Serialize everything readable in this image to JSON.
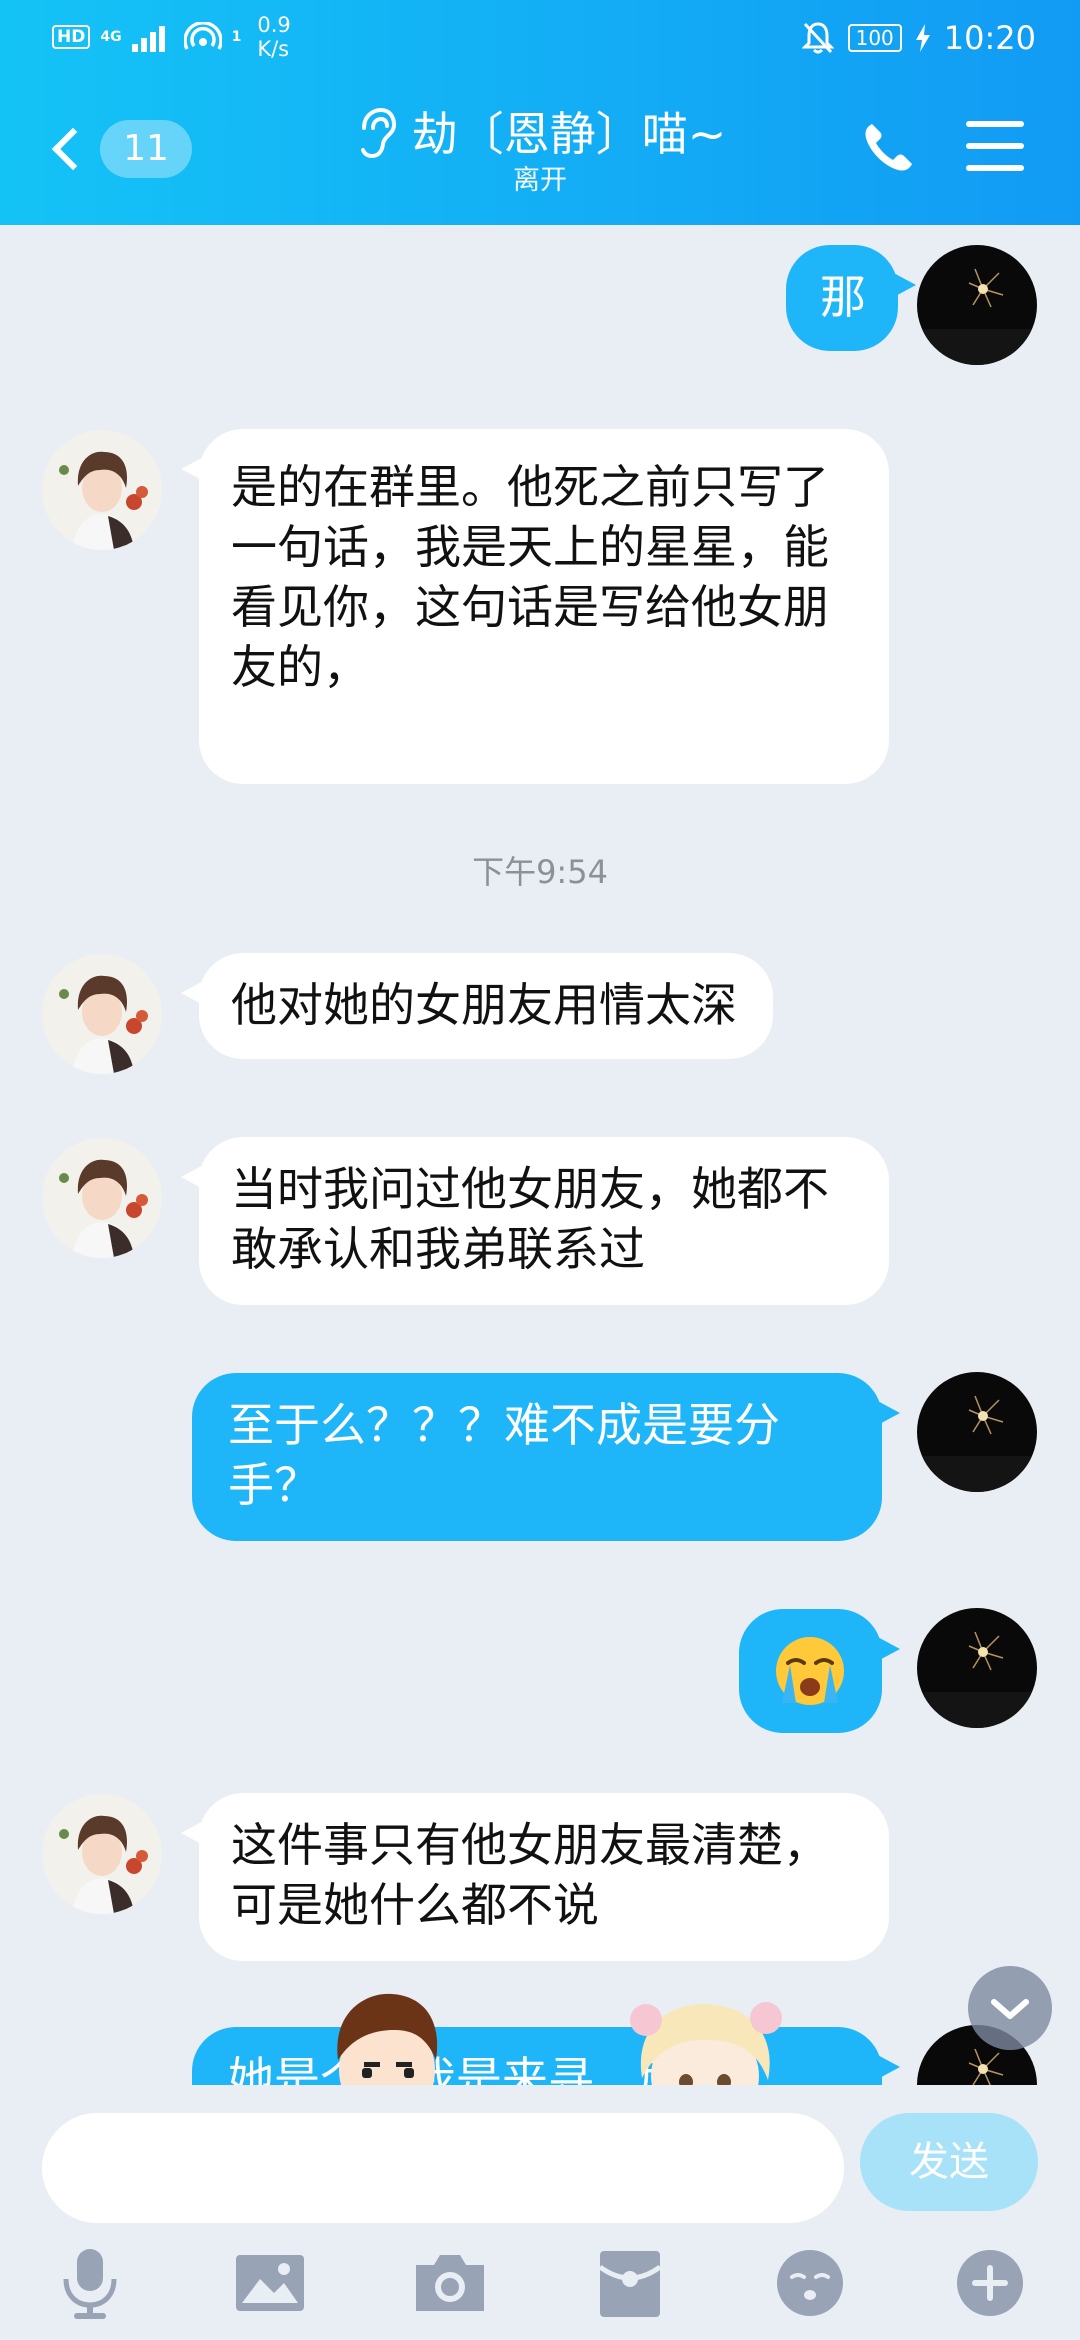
{
  "status_bar": {
    "hd_label": "HD",
    "network": "4G",
    "hotspot_count": "1",
    "speed_value": "0.9",
    "speed_unit": "K/s",
    "battery": "100",
    "time": "10:20"
  },
  "header": {
    "unread_count": "11",
    "contact_name": "劫〔恩静〕喵~",
    "contact_status": "离开"
  },
  "messages": [
    {
      "side": "out",
      "text": "那"
    },
    {
      "side": "in",
      "text": "是的在群里。他死之前只写了一句话，我是天上的星星，能看见你，这句话是写给他女朋友的，"
    },
    {
      "type": "time",
      "text": "下午9:54"
    },
    {
      "side": "in",
      "text": "他对她的女朋友用情太深"
    },
    {
      "side": "in",
      "text": "当时我问过他女朋友，她都不敢承认和我弟联系过"
    },
    {
      "side": "out",
      "text": "至于么？？？难不成是要分手？"
    },
    {
      "side": "out",
      "emoji": "crying-face"
    },
    {
      "side": "in",
      "text": "这件事只有他女朋友最清楚，可是她什么都不说"
    },
    {
      "side": "out",
      "text": "她是个...我是来寻...后"
    }
  ],
  "input": {
    "placeholder": "",
    "send_label": "发送"
  },
  "toolbar_icons": [
    "microphone-icon",
    "image-icon",
    "camera-icon",
    "red-packet-icon",
    "emoticon-icon",
    "plus-icon"
  ],
  "colors": {
    "header_start": "#14C3F6",
    "header_end": "#129BF4",
    "outgoing_bubble": "#1FB6F9",
    "incoming_bubble": "#FFFFFF",
    "chat_background": "#E9EDF4",
    "send_button": "#A7E2F9"
  }
}
